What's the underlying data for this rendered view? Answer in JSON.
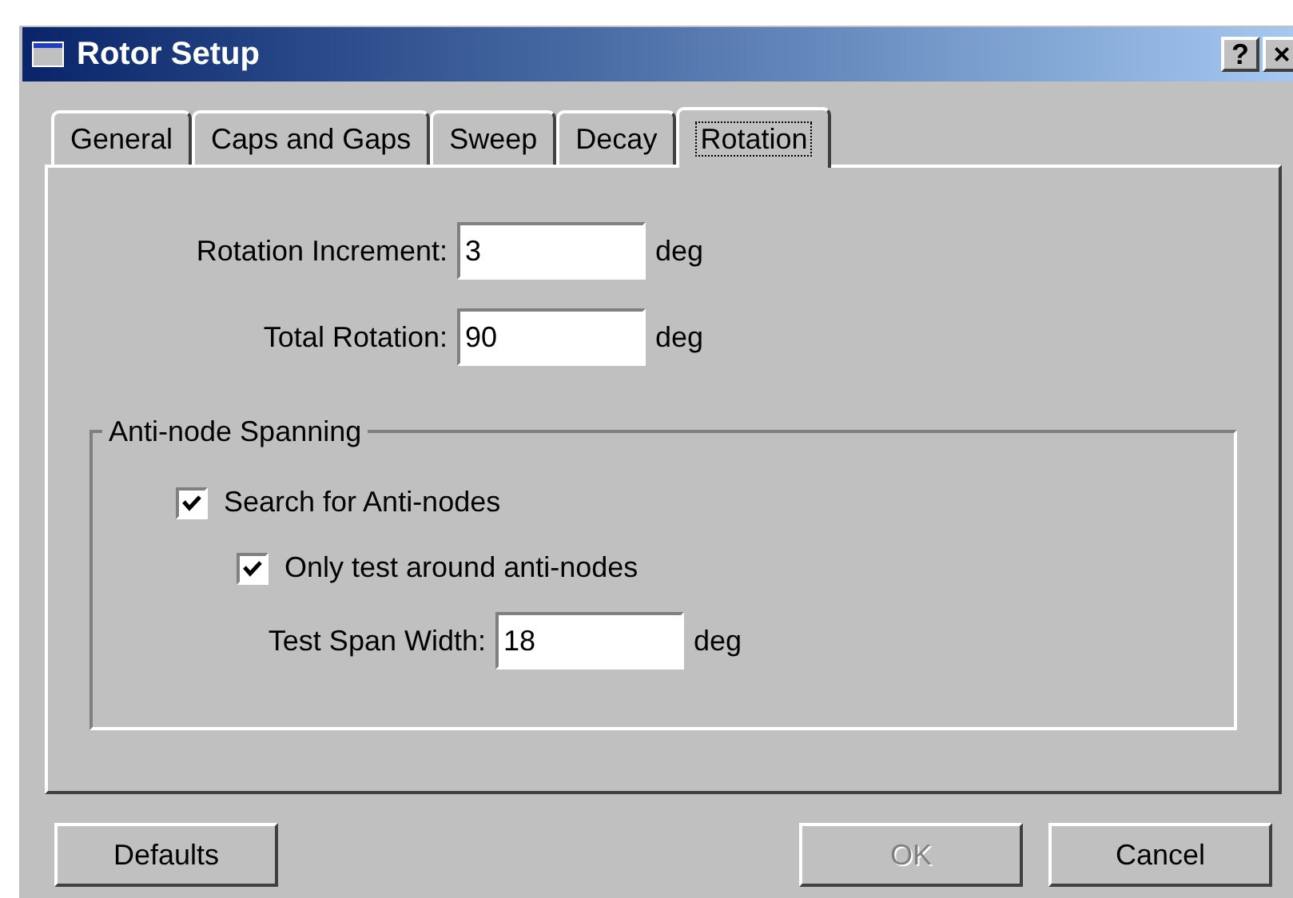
{
  "window": {
    "title": "Rotor Setup",
    "title_buttons": [
      "?",
      "×"
    ]
  },
  "tabs": [
    {
      "label": "General",
      "selected": false
    },
    {
      "label": "Caps and Gaps",
      "selected": false
    },
    {
      "label": "Sweep",
      "selected": false
    },
    {
      "label": "Decay",
      "selected": false
    },
    {
      "label": "Rotation",
      "selected": true
    }
  ],
  "fields": [
    {
      "label": "Rotation Increment:",
      "value": "3",
      "unit": "deg"
    },
    {
      "label": "Total Rotation:",
      "value": "90",
      "unit": "deg"
    }
  ],
  "group": {
    "title": "Anti-node Spanning",
    "options": [
      {
        "label": "Search for Anti-nodes",
        "checked": true,
        "children": [
          {
            "label": "Only test around anti-nodes",
            "checked": true
          }
        ]
      }
    ],
    "span_field": {
      "label": "Test Span Width:",
      "value": "18",
      "unit": "deg"
    }
  },
  "buttons": [
    {
      "label": "Defaults",
      "disabled": false
    },
    {
      "label": "OK",
      "disabled": true
    },
    {
      "label": "Cancel",
      "disabled": false
    }
  ]
}
